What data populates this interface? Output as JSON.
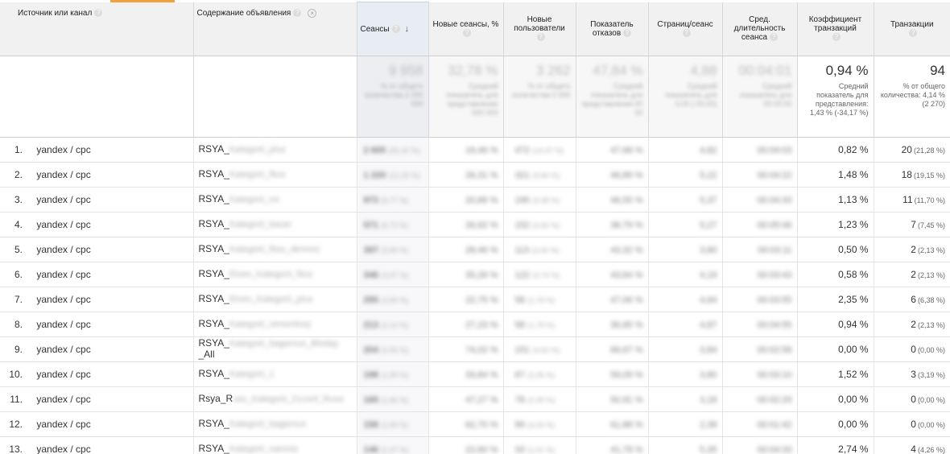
{
  "columns": {
    "source": "Источник или канал",
    "ad_content": "Содержание объявления",
    "sessions": "Сеансы",
    "new_sessions": "Новые сеансы, %",
    "new_users": "Новые пользователи",
    "bounce_rate": "Показатель отказов",
    "pages_per_session": "Страниц/сеанс",
    "avg_duration": "Сред. длительность сеанса",
    "conversion_rate": "Коэффициент транзакций",
    "transactions": "Транзакции"
  },
  "summary": {
    "sessions": "9 958",
    "new_sessions": "32,78 %",
    "new_users": "3 262",
    "bounce_rate": "47,84 %",
    "pages_per_session": "4,88",
    "avg_duration": "00:04:01",
    "conversion_rate": "0,94 %",
    "conversion_rate_note": "Средний показатель для представления: 1,43 % (-34,17 %)",
    "transactions": "94",
    "transactions_note": "% от общего количества: 4,14 % (2 270)"
  },
  "rows": [
    {
      "idx": "1.",
      "source": "yandex / cpc",
      "ad": "RSYA_",
      "ad_tail": "Kategorii_plus",
      "sessions": "2 605",
      "sess_pct": "(26,16 %)",
      "new_sess": "19,46 %",
      "new_users": "472",
      "nu_pct": "(14,47 %)",
      "bounce": "47,68 %",
      "pps": "4,82",
      "dur": "00:04:03",
      "conv": "0,82 %",
      "tr": "20",
      "tr_pct": "(21,28 %)"
    },
    {
      "idx": "2.",
      "source": "yandex / cpc",
      "ad": "RSYA_",
      "ad_tail": "Kategorii_fitus",
      "sessions": "1 220",
      "sess_pct": "(12,25 %)",
      "new_sess": "26,31 %",
      "new_users": "321",
      "nu_pct": "(9,84 %)",
      "bounce": "46,89 %",
      "pps": "5,22",
      "dur": "00:04:22",
      "conv": "1,48 %",
      "tr": "18",
      "tr_pct": "(19,15 %)"
    },
    {
      "idx": "3.",
      "source": "yandex / cpc",
      "ad": "RSYA_",
      "ad_tail": "Kategorii_mr",
      "sessions": "973",
      "sess_pct": "(9,77 %)",
      "new_sess": "20,86 %",
      "new_users": "195",
      "nu_pct": "(5,98 %)",
      "bounce": "46,55 %",
      "pps": "5,37",
      "dur": "00:04:33",
      "conv": "1,13 %",
      "tr": "11",
      "tr_pct": "(11,70 %)"
    },
    {
      "idx": "4.",
      "source": "yandex / cpc",
      "ad": "RSYA_",
      "ad_tail": "Kategorii_bauer",
      "sessions": "571",
      "sess_pct": "(5,73 %)",
      "new_sess": "26,62 %",
      "new_users": "152",
      "nu_pct": "(4,66 %)",
      "bounce": "38,79 %",
      "pps": "5,27",
      "dur": "00:05:06",
      "conv": "1,23 %",
      "tr": "7",
      "tr_pct": "(7,45 %)"
    },
    {
      "idx": "5.",
      "source": "yandex / cpc",
      "ad": "RSYA_",
      "ad_tail": "Kategorii_fitus_demrez",
      "sessions": "397",
      "sess_pct": "(3,99 %)",
      "new_sess": "28,46 %",
      "new_users": "113",
      "nu_pct": "(3,46 %)",
      "bounce": "43,32 %",
      "pps": "3,80",
      "dur": "00:03:11",
      "conv": "0,50 %",
      "tr": "2",
      "tr_pct": "(2,13 %)"
    },
    {
      "idx": "6.",
      "source": "yandex / cpc",
      "ad": "RSYA_",
      "ad_tail": "Elven_Kategorii_fitus",
      "sessions": "346",
      "sess_pct": "(3,47 %)",
      "new_sess": "35,26 %",
      "new_users": "122",
      "nu_pct": "(3,74 %)",
      "bounce": "43,64 %",
      "pps": "4,19",
      "dur": "00:03:43",
      "conv": "0,58 %",
      "tr": "2",
      "tr_pct": "(2,13 %)"
    },
    {
      "idx": "7.",
      "source": "yandex / cpc",
      "ad": "RSYA_",
      "ad_tail": "Elven_Kategorii_plus",
      "sessions": "255",
      "sess_pct": "(2,56 %)",
      "new_sess": "22,75 %",
      "new_users": "58",
      "nu_pct": "(1,78 %)",
      "bounce": "47,06 %",
      "pps": "4,64",
      "dur": "00:03:55",
      "conv": "2,35 %",
      "tr": "6",
      "tr_pct": "(6,38 %)"
    },
    {
      "idx": "8.",
      "source": "yandex / cpc",
      "ad": "RSYA_",
      "ad_tail": "Kategorii_remontnoy",
      "sessions": "213",
      "sess_pct": "(2,14 %)",
      "new_sess": "27,23 %",
      "new_users": "58",
      "nu_pct": "(1,78 %)",
      "bounce": "36,65 %",
      "pps": "4,87",
      "dur": "00:04:55",
      "conv": "0,94 %",
      "tr": "2",
      "tr_pct": "(2,13 %)"
    },
    {
      "idx": "9.",
      "source": "yandex / cpc",
      "ad": "RSYA_",
      "ad_tail": "Kategorii_bagernus_Bloday",
      "ad_line2": "_All",
      "sessions": "204",
      "sess_pct": "(2,05 %)",
      "new_sess": "74,02 %",
      "new_users": "151",
      "nu_pct": "(4,63 %)",
      "bounce": "66,67 %",
      "pps": "3,84",
      "dur": "00:02:58",
      "conv": "0,00 %",
      "tr": "0",
      "tr_pct": "(0,00 %)"
    },
    {
      "idx": "10.",
      "source": "yandex / cpc",
      "ad": "RSYA_",
      "ad_tail": "Kategorii_1",
      "sessions": "198",
      "sess_pct": "(1,99 %)",
      "new_sess": "33,84 %",
      "new_users": "67",
      "nu_pct": "(2,05 %)",
      "bounce": "59,09 %",
      "pps": "3,80",
      "dur": "00:03:10",
      "conv": "1,52 %",
      "tr": "3",
      "tr_pct": "(3,19 %)"
    },
    {
      "idx": "11.",
      "source": "yandex / cpc",
      "ad": "Rsya_R",
      "ad_tail": "uss_Kategorii_21conf_Rusa",
      "sessions": "165",
      "sess_pct": "(1,66 %)",
      "new_sess": "47,27 %",
      "new_users": "78",
      "nu_pct": "(2,39 %)",
      "bounce": "50,91 %",
      "pps": "3,18",
      "dur": "00:02:29",
      "conv": "0,00 %",
      "tr": "0",
      "tr_pct": "(0,00 %)"
    },
    {
      "idx": "12.",
      "source": "yandex / cpc",
      "ad": "RSYA_",
      "ad_tail": "Kategorii_bagernus",
      "sessions": "158",
      "sess_pct": "(1,59 %)",
      "new_sess": "62,70 %",
      "new_users": "99",
      "nu_pct": "(3,03 %)",
      "bounce": "61,88 %",
      "pps": "2,39",
      "dur": "00:01:42",
      "conv": "0,00 %",
      "tr": "0",
      "tr_pct": "(0,00 %)"
    },
    {
      "idx": "13.",
      "source": "yandex / cpc",
      "ad": "RSYA_",
      "ad_tail": "Kategorii_naroniz",
      "sessions": "146",
      "sess_pct": "(1,47 %)",
      "new_sess": "22,60 %",
      "new_users": "33",
      "nu_pct": "(1,01 %)",
      "bounce": "41,78 %",
      "pps": "5,35",
      "dur": "00:04:33",
      "conv": "2,74 %",
      "tr": "4",
      "tr_pct": "(4,26 %)"
    }
  ]
}
